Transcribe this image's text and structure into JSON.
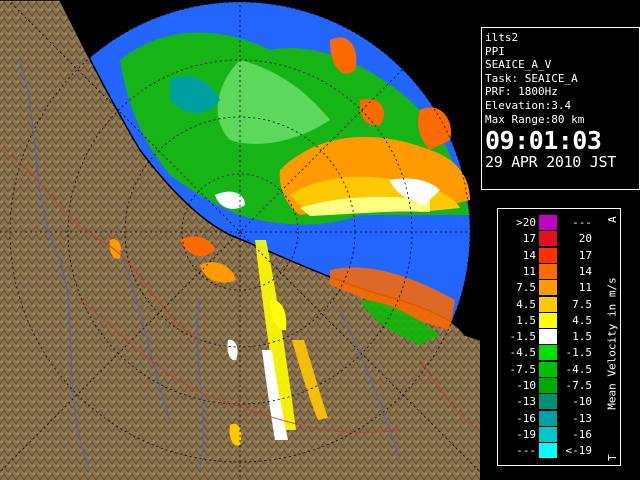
{
  "info": {
    "lines": [
      "ilts2",
      "PPI",
      "SEAICE_A_V",
      "Task: SEAICE_A",
      "PRF: 1800Hz",
      "Elevation:3.4",
      "Max Range:80 km"
    ],
    "time": "09:01:03",
    "date": "29 APR 2010 JST"
  },
  "legend": {
    "unit_label": "Mean Velocity in m/s",
    "top_mark": "A",
    "bottom_mark": "T",
    "rows": [
      {
        "lo": ">20",
        "hi": "---",
        "color": "#c000c0"
      },
      {
        "lo": "17",
        "hi": "20",
        "color": "#e01020"
      },
      {
        "lo": "14",
        "hi": "17",
        "color": "#ff3000"
      },
      {
        "lo": "11",
        "hi": "14",
        "color": "#ff6a00"
      },
      {
        "lo": "7.5",
        "hi": "11",
        "color": "#ff9a00"
      },
      {
        "lo": "4.5",
        "hi": "7.5",
        "color": "#ffc800"
      },
      {
        "lo": "1.5",
        "hi": "4.5",
        "color": "#ffff00"
      },
      {
        "lo": "-1.5",
        "hi": "1.5",
        "color": "#ffffff"
      },
      {
        "lo": "-4.5",
        "hi": "-1.5",
        "color": "#00e000"
      },
      {
        "lo": "-7.5",
        "hi": "-4.5",
        "color": "#00c000"
      },
      {
        "lo": "-10",
        "hi": "-7.5",
        "color": "#00a800"
      },
      {
        "lo": "-13",
        "hi": "-10",
        "color": "#009070"
      },
      {
        "lo": "-16",
        "hi": "-13",
        "color": "#00a0a0"
      },
      {
        "lo": "-19",
        "hi": "-16",
        "color": "#00c8c8"
      },
      {
        "lo": "---",
        "hi": "<-19",
        "color": "#00ffff"
      }
    ]
  },
  "colors": {
    "background": "#000000",
    "land": "#8c7350",
    "sea_echo": "#2266ff"
  }
}
